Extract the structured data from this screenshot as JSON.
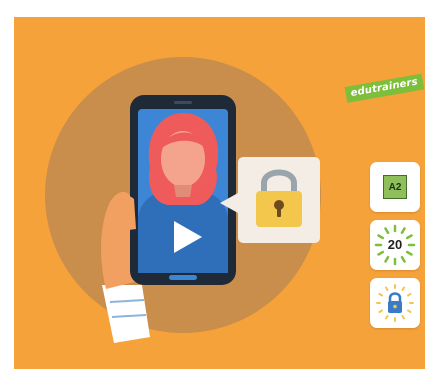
{
  "brand": {
    "label": "edutrainers"
  },
  "badges": {
    "level": {
      "label": "A2",
      "icon": "level-badge-icon"
    },
    "duration": {
      "label": "20",
      "icon": "duration-ring-icon"
    },
    "security": {
      "icon": "padlock-icon"
    }
  },
  "colors": {
    "background": "#f6a23a",
    "circle": "#c98d4c",
    "brand_green": "#7dbe3b",
    "phone_frame": "#1f2a38",
    "screen_blue": "#3d86d6",
    "lock_yellow": "#f3c64c"
  }
}
